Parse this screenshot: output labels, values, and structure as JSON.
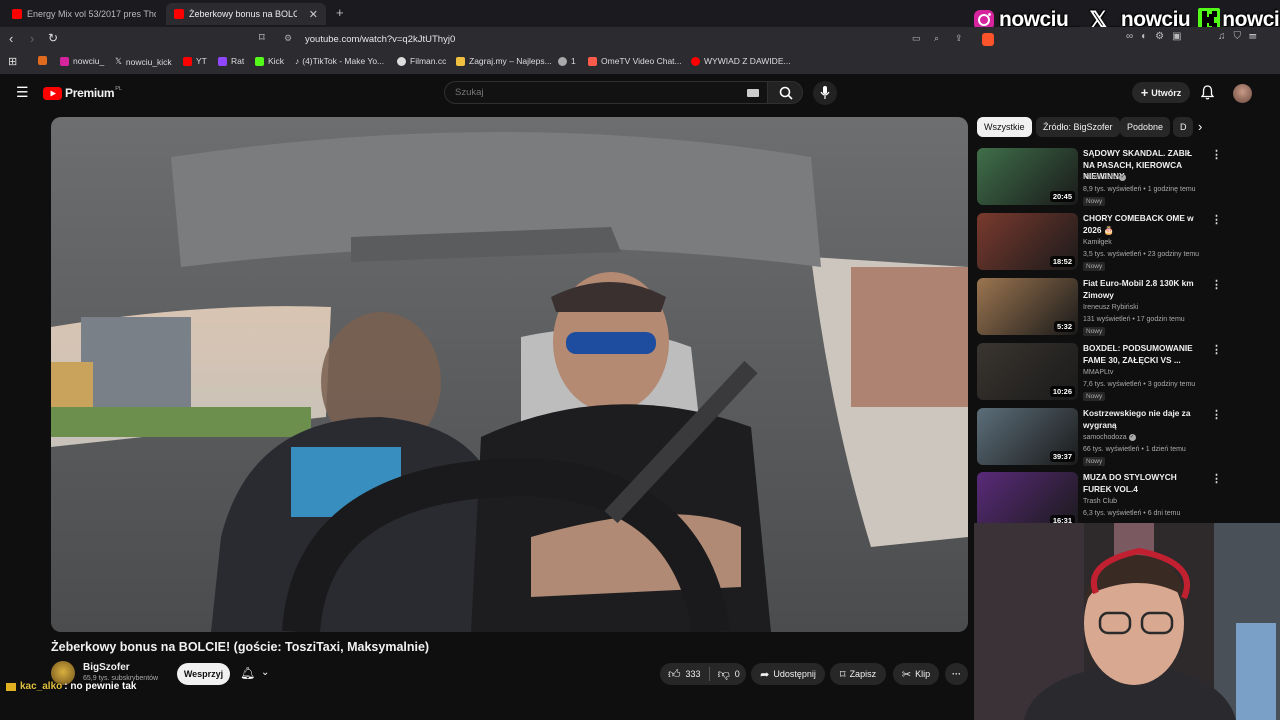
{
  "browser": {
    "tabs": [
      {
        "label": "Energy Mix vol 53/2017 pres Tho",
        "active": false
      },
      {
        "label": "Żeberkowy bonus na BOLCIE!",
        "active": true
      }
    ],
    "url": "youtube.com/watch?v=q2kJtUThyj0",
    "bookmarks": [
      {
        "label": "",
        "icon": "grid-icon",
        "color": "#888"
      },
      {
        "label": "",
        "icon": "folder-icon",
        "color": "#e06b1f"
      },
      {
        "label": "nowciu_",
        "icon": "instagram-icon",
        "color": "#d6249f"
      },
      {
        "label": "nowciu_kick",
        "icon": "x-icon",
        "color": "#ffffff"
      },
      {
        "label": "YT",
        "icon": "youtube-icon",
        "color": "#ff0000"
      },
      {
        "label": "Rat",
        "icon": "twitch-icon",
        "color": "#9146ff"
      },
      {
        "label": "Kick",
        "icon": "kick-icon",
        "color": "#53fc18"
      },
      {
        "label": "(4)TikTok - Make Yo...",
        "icon": "tiktok-icon",
        "color": "#ffffff"
      },
      {
        "label": "Filman.cc",
        "icon": "filman-icon",
        "color": "#ffffff"
      },
      {
        "label": "Zagraj.my – Najleps...",
        "icon": "zagraj-icon",
        "color": "#f0c040"
      },
      {
        "label": "1",
        "icon": "globe-icon",
        "color": "#aaaaaa"
      },
      {
        "label": "OmeTV Video Chat...",
        "icon": "ometv-icon",
        "color": "#ff5b4a"
      },
      {
        "label": "WYWIAD Z DAWIDE...",
        "icon": "youtube-icon",
        "color": "#ff0000"
      }
    ]
  },
  "overlay": {
    "instagram": "nowciu_",
    "x": "_nowciu",
    "kick": "nowciu",
    "chat_user": "kac_alko",
    "chat_message": ": no pewnie tak"
  },
  "youtube": {
    "logo": "Premium",
    "logo_sup": "PL",
    "search_placeholder": "Szukaj",
    "create_label": "Utwórz"
  },
  "video": {
    "title": "Żeberkowy bonus na BOLCIE! (goście: TosziTaxi, Maksymalnie)",
    "channel": "BigSzofer",
    "subscribers": "65,9 tys. subskrybentów",
    "support_label": "Wesprzyj",
    "likes": "333",
    "dislikes": "0",
    "share_label": "Udostępnij",
    "save_label": "Zapisz",
    "clip_label": "Klip"
  },
  "chips": [
    {
      "label": "Wszystkie",
      "active": true
    },
    {
      "label": "Źródło: BigSzofer",
      "active": false
    },
    {
      "label": "Podobne",
      "active": false
    },
    {
      "label": "D",
      "active": false
    }
  ],
  "recommendations": [
    {
      "title": "SĄDOWY SKANDAL. ZABIŁ NA PASACH, KIEROWCA NIEWINNY",
      "channel": "Kanał Zero",
      "verified": true,
      "meta": "8,9 tys. wyświetleń • 1 godzinę temu",
      "badge": "Nowy",
      "duration": "20:45",
      "thumb_color": "#3f6f4a"
    },
    {
      "title": "CHORY COMEBACK OME w 2026 🎂",
      "channel": "Kamiłgek",
      "verified": false,
      "meta": "3,5 tys. wyświetleń • 23 godziny temu",
      "badge": "Nowy",
      "duration": "18:52",
      "thumb_color": "#7a3a2e"
    },
    {
      "title": "Fiat Euro-Mobil 2.8 130K km Zimowy",
      "channel": "Ireneusz Rybiński",
      "verified": false,
      "meta": "131 wyświetleń • 17 godzin temu",
      "badge": "Nowy",
      "duration": "5:32",
      "thumb_color": "#9b7550"
    },
    {
      "title": "BOXDEL: PODSUMOWANIE FAME 30, ZAŁĘCKI VS ...",
      "channel": "MMAPLtv",
      "verified": false,
      "meta": "7,6 tys. wyświetleń • 3 godziny temu",
      "badge": "Nowy",
      "duration": "10:26",
      "thumb_color": "#3a3530"
    },
    {
      "title": "Kostrzewskiego nie daje za wygraną",
      "channel": "samochodoza",
      "verified": true,
      "meta": "66 tys. wyświetleń • 1 dzień temu",
      "badge": "Nowy",
      "duration": "39:37",
      "thumb_color": "#5c6e7a"
    },
    {
      "title": "MUZA DO STYLOWYCH FUREK VOL.4",
      "channel": "Trash Club",
      "verified": false,
      "meta": "6,3 tys. wyświetleń • 6 dni temu",
      "badge": "",
      "duration": "16:31",
      "thumb_color": "#5a2a7a"
    }
  ]
}
